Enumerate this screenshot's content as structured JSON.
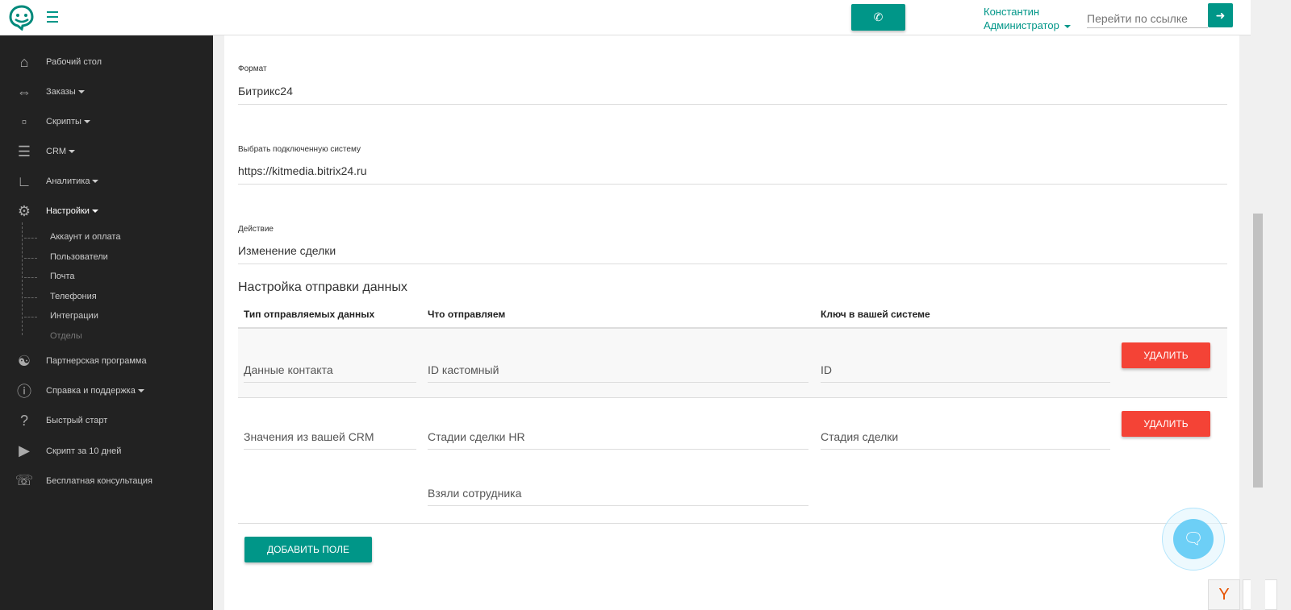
{
  "header": {
    "user_name": "Константин",
    "user_role": "Администратор",
    "link_placeholder": "Перейти по ссылке"
  },
  "sidebar": {
    "items": [
      {
        "label": "Рабочий стол",
        "icon": "home-icon"
      },
      {
        "label": "Заказы",
        "icon": "orders-icon",
        "caret": true
      },
      {
        "label": "Скрипты",
        "icon": "clipboard-icon",
        "caret": true
      },
      {
        "label": "CRM",
        "icon": "list-icon",
        "caret": true
      },
      {
        "label": "Аналитика",
        "icon": "chart-icon",
        "caret": true
      },
      {
        "label": "Настройки",
        "icon": "gears-icon",
        "caret": true
      }
    ],
    "subitems": [
      "Аккаунт и оплата",
      "Пользователи",
      "Почта",
      "Телефония",
      "Интеграции",
      "Отделы"
    ],
    "bottom_items": [
      {
        "label": "Партнерская программа",
        "icon": "handshake-icon"
      },
      {
        "label": "Справка и поддержка",
        "icon": "info-icon",
        "caret": true
      },
      {
        "label": "Быстрый старт",
        "icon": "question-icon"
      },
      {
        "label": "Скрипт за 10 дней",
        "icon": "youtube-icon"
      },
      {
        "label": "Бесплатная консультация",
        "icon": "phone-square-icon"
      }
    ]
  },
  "form": {
    "format_label": "Формат",
    "format_value": "Битрикс24",
    "system_label": "Выбрать подключенную систему",
    "system_value": "https://kitmedia.bitrix24.ru",
    "action_label": "Действие",
    "action_value": "Изменение сделки",
    "section_title": "Настройка отправки данных",
    "columns": [
      "Тип отправляемых данных",
      "Что отправляем",
      "Ключ в вашей системе"
    ],
    "rows": [
      {
        "type": "Данные контакта",
        "what": [
          "ID кастомный"
        ],
        "key": "ID"
      },
      {
        "type": "Значения из вашей CRM",
        "what": [
          "Стадии сделки HR",
          "Взяли сотрудника"
        ],
        "key": "Стадия сделки"
      }
    ],
    "delete_label": "УДАЛИТЬ",
    "add_label": "ДОБАВИТЬ ПОЛЕ"
  },
  "colors": {
    "accent": "#009688",
    "danger": "#f44336",
    "sidebar": "#222222"
  }
}
